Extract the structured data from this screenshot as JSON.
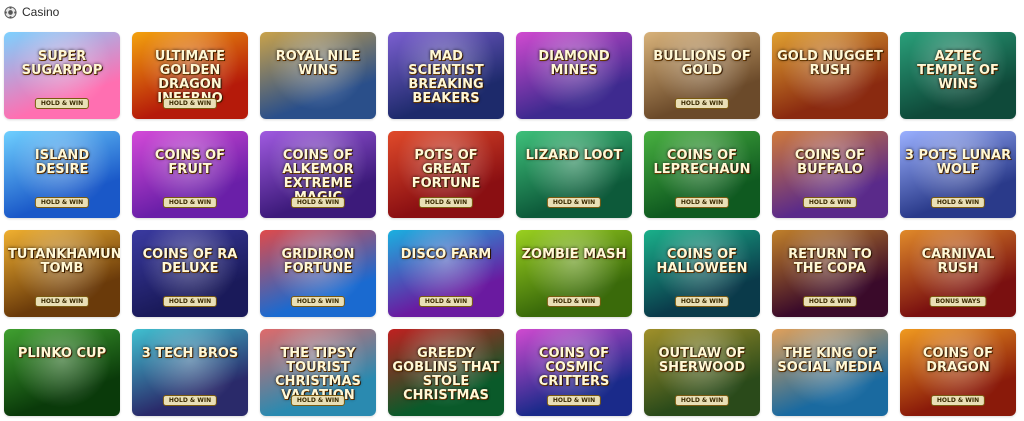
{
  "header": {
    "title": "Casino",
    "icon": "casino-chip-icon"
  },
  "games": [
    {
      "name": "Super Sugarpop",
      "badge": "HOLD & WIN",
      "color_a": "#ff6fb1",
      "color_b": "#7cd1ff"
    },
    {
      "name": "Ultimate Golden Dragon Inferno",
      "badge": "HOLD & WIN",
      "color_a": "#b51a0a",
      "color_b": "#f3a20e"
    },
    {
      "name": "Royal Nile Wins",
      "badge": "",
      "color_a": "#2a4f8a",
      "color_b": "#c9a24a"
    },
    {
      "name": "Mad Scientist Breaking Beakers",
      "badge": "",
      "color_a": "#1d2a6b",
      "color_b": "#7b5fd0"
    },
    {
      "name": "Diamond Mines",
      "badge": "",
      "color_a": "#3e2a8f",
      "color_b": "#d14ad0"
    },
    {
      "name": "Bullions of Gold",
      "badge": "HOLD & WIN",
      "color_a": "#6b4a2a",
      "color_b": "#d8b27a"
    },
    {
      "name": "Gold Nugget Rush",
      "badge": "",
      "color_a": "#8a2a10",
      "color_b": "#e0a030"
    },
    {
      "name": "Aztec Temple of Wins",
      "badge": "",
      "color_a": "#0f4a3a",
      "color_b": "#2aa07a"
    },
    {
      "name": "Island Desire",
      "badge": "HOLD & WIN",
      "color_a": "#1a58c8",
      "color_b": "#6fd0ff"
    },
    {
      "name": "Coins of Fruit",
      "badge": "HOLD & WIN",
      "color_a": "#6a1fa8",
      "color_b": "#d44ad8"
    },
    {
      "name": "Coins of Alkemor Extreme Magic",
      "badge": "HOLD & WIN",
      "color_a": "#3c1a7a",
      "color_b": "#a05ae0"
    },
    {
      "name": "Pots of Great Fortune",
      "badge": "HOLD & WIN",
      "color_a": "#8a0f12",
      "color_b": "#e04a2a"
    },
    {
      "name": "Lizard Loot",
      "badge": "HOLD & WIN",
      "color_a": "#0d5a3a",
      "color_b": "#3ec07a"
    },
    {
      "name": "Coins of Leprechaun",
      "badge": "HOLD & WIN",
      "color_a": "#0f5a20",
      "color_b": "#48b040"
    },
    {
      "name": "Coins of Buffalo",
      "badge": "HOLD & WIN",
      "color_a": "#5a2a8a",
      "color_b": "#d07a3a"
    },
    {
      "name": "3 Pots Lunar Wolf",
      "badge": "HOLD & WIN",
      "color_a": "#2a3a8a",
      "color_b": "#9ab0ff"
    },
    {
      "name": "Tutankhamun's Tomb",
      "badge": "HOLD & WIN",
      "color_a": "#6a3a0a",
      "color_b": "#f0b030"
    },
    {
      "name": "Coins of Ra Deluxe",
      "badge": "HOLD & WIN",
      "color_a": "#1a1a5a",
      "color_b": "#3a3aa0"
    },
    {
      "name": "Gridiron Fortune",
      "badge": "HOLD & WIN",
      "color_a": "#1a6ad0",
      "color_b": "#e04a4a"
    },
    {
      "name": "Disco Farm",
      "badge": "HOLD & WIN",
      "color_a": "#6a1aa0",
      "color_b": "#1ab0e0"
    },
    {
      "name": "Zombie Mash",
      "badge": "HOLD & WIN",
      "color_a": "#3a6a0a",
      "color_b": "#9ad020"
    },
    {
      "name": "Coins of Halloween",
      "badge": "HOLD & WIN",
      "color_a": "#0a3a4a",
      "color_b": "#1ab08a"
    },
    {
      "name": "Return to the Copa",
      "badge": "HOLD & WIN",
      "color_a": "#3a0a2a",
      "color_b": "#c0802a"
    },
    {
      "name": "Carnival Rush",
      "badge": "BONUS WAYS",
      "color_a": "#7a1010",
      "color_b": "#e08a2a"
    },
    {
      "name": "Plinko Cup",
      "badge": "",
      "color_a": "#0a3a0a",
      "color_b": "#40a030"
    },
    {
      "name": "3 Tech Bros",
      "badge": "HOLD & WIN",
      "color_a": "#2a2a6a",
      "color_b": "#40c0d0"
    },
    {
      "name": "The Tipsy Tourist Christmas Vacation",
      "badge": "HOLD & WIN",
      "color_a": "#2a8ab0",
      "color_b": "#e06a6a"
    },
    {
      "name": "Greedy Goblins That Stole Christmas",
      "badge": "",
      "color_a": "#0a5a2a",
      "color_b": "#c02020"
    },
    {
      "name": "Coins of Cosmic Critters",
      "badge": "HOLD & WIN",
      "color_a": "#1a2a8a",
      "color_b": "#d04ad0"
    },
    {
      "name": "Outlaw of Sherwood",
      "badge": "HOLD & WIN",
      "color_a": "#2a4a1a",
      "color_b": "#a0902a"
    },
    {
      "name": "The King of Social Media",
      "badge": "",
      "color_a": "#1a6aa0",
      "color_b": "#e0a05a"
    },
    {
      "name": "Coins of Dragon",
      "badge": "HOLD & WIN",
      "color_a": "#8a1a0a",
      "color_b": "#f09a20"
    }
  ]
}
